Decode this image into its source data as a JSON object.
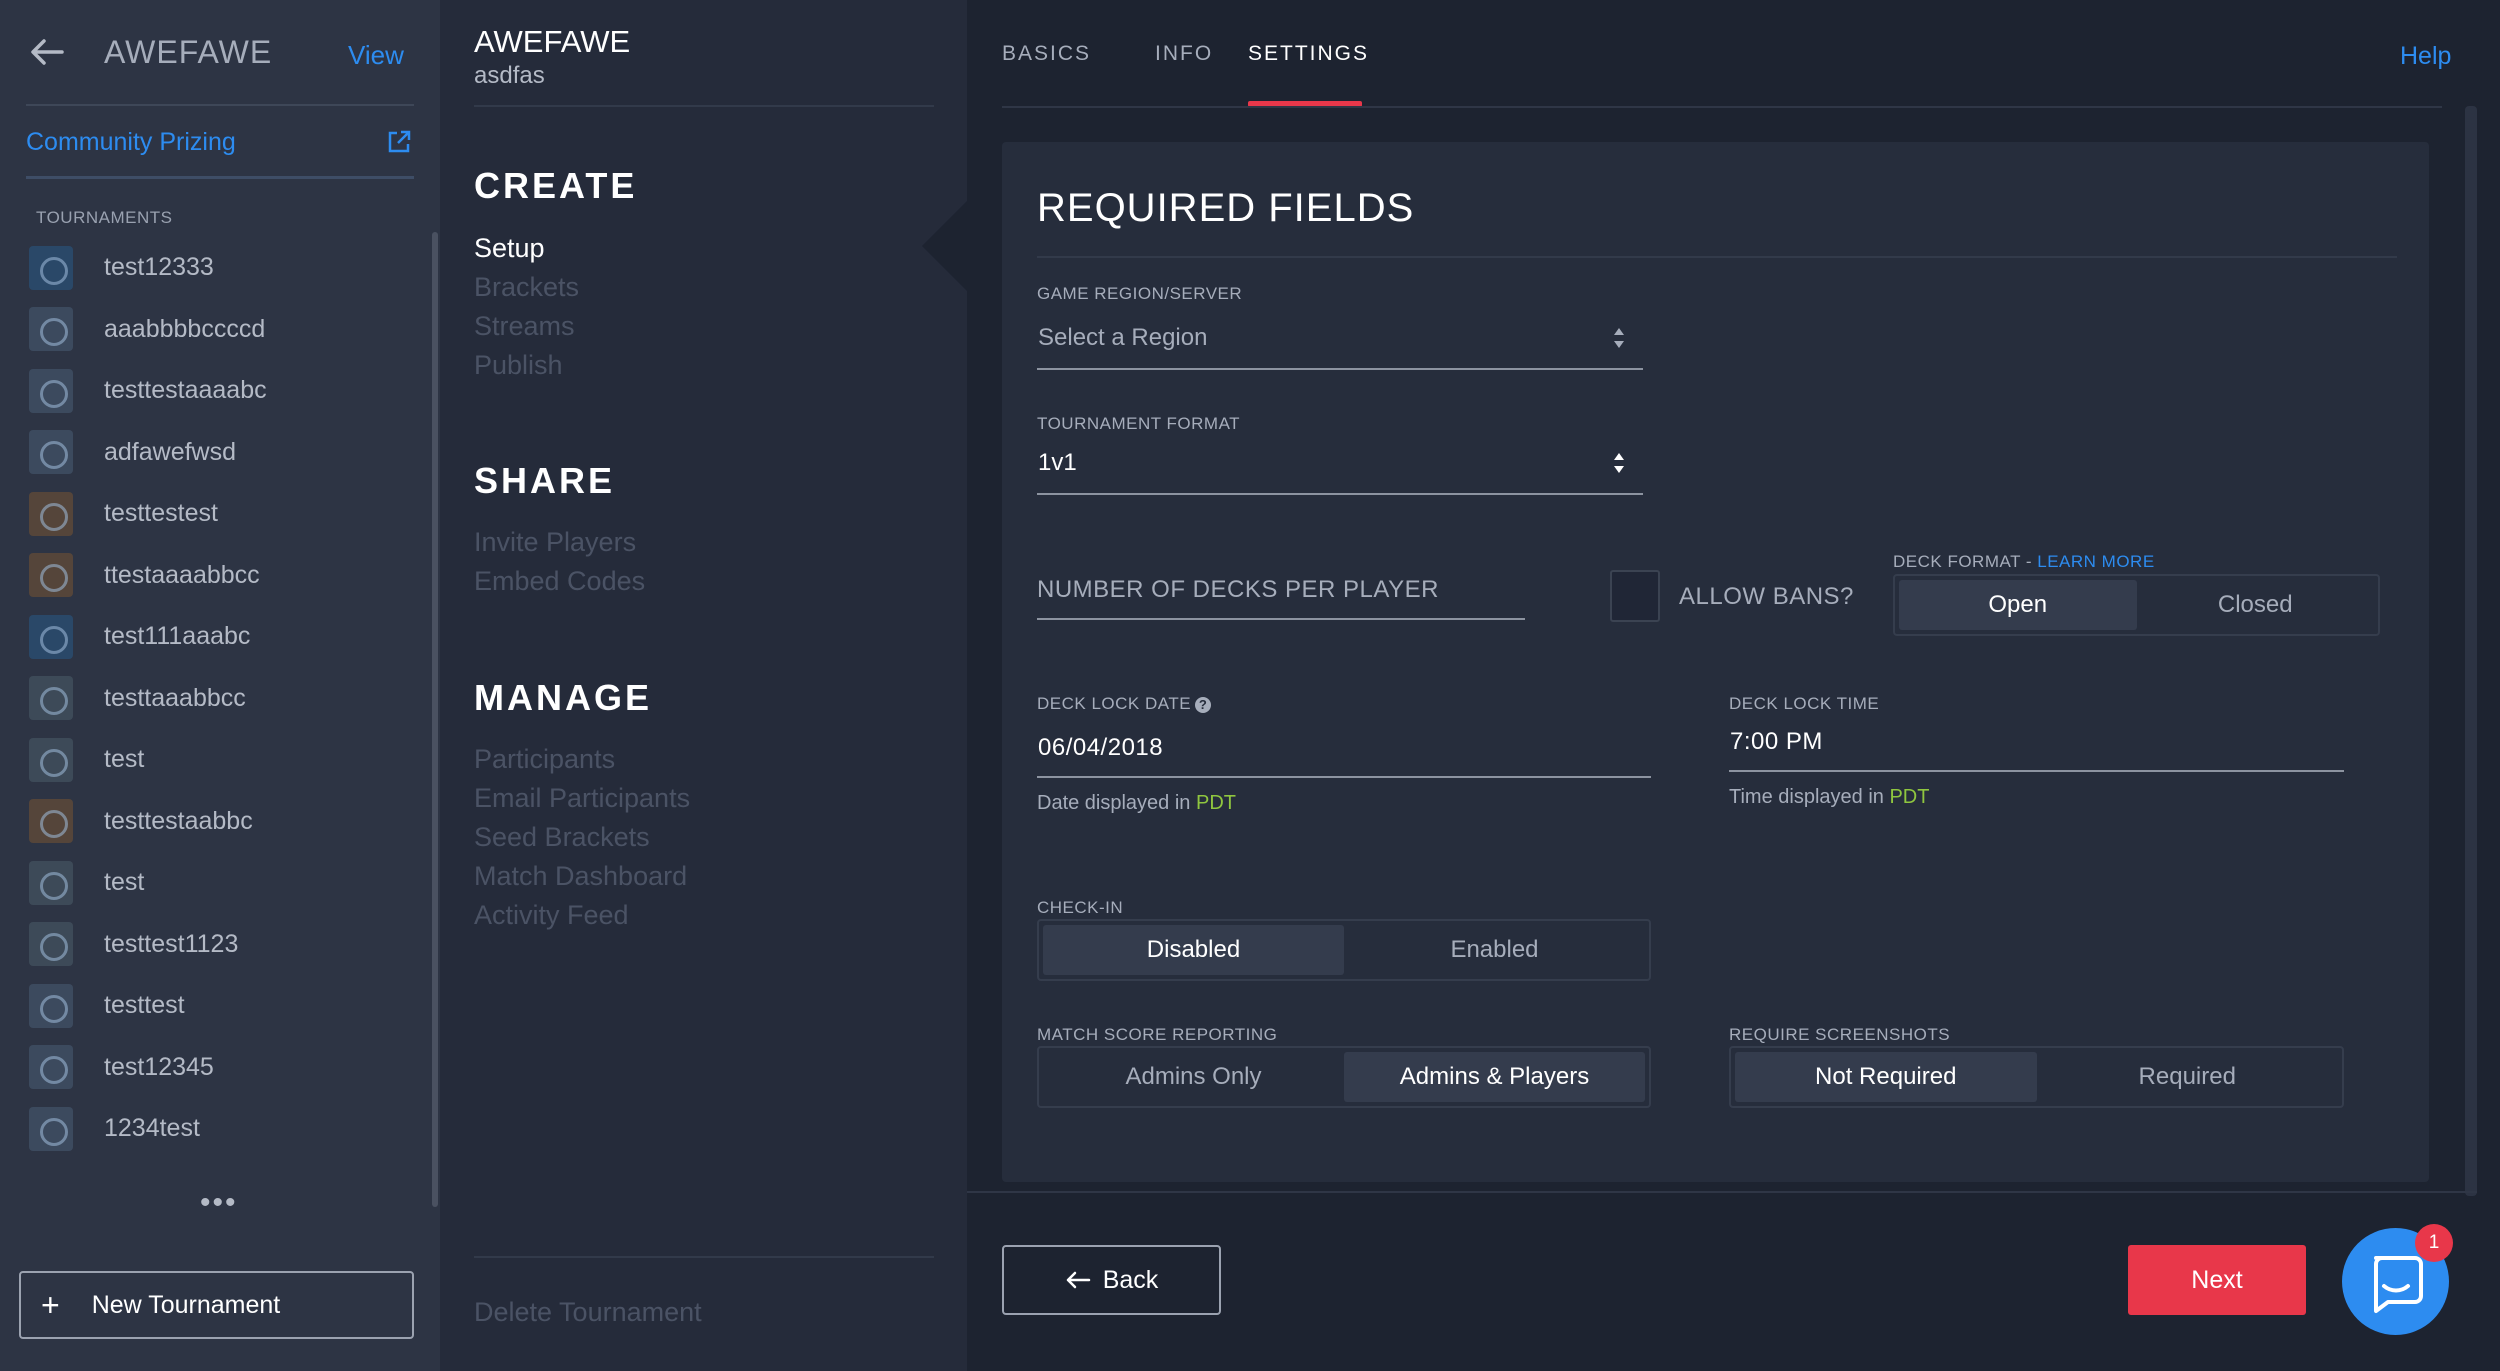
{
  "sidebar": {
    "title": "AWEFAWE",
    "view_label": "View",
    "community_prizing": "Community Prizing",
    "section_label": "TOURNAMENTS",
    "tournaments": [
      {
        "name": "test12333"
      },
      {
        "name": "aaabbbbccccd"
      },
      {
        "name": "testtestaaaabc"
      },
      {
        "name": "adfawefwsd"
      },
      {
        "name": "testtestest"
      },
      {
        "name": "ttestaaaabbcc"
      },
      {
        "name": "test111aaabc"
      },
      {
        "name": "testtaaabbcc"
      },
      {
        "name": "test"
      },
      {
        "name": "testtestaabbc"
      },
      {
        "name": "test"
      },
      {
        "name": "testtest1123"
      },
      {
        "name": "testtest"
      },
      {
        "name": "test12345"
      },
      {
        "name": "1234test"
      }
    ],
    "more": "•••",
    "new_tournament_label": "New Tournament",
    "new_tournament_plus": "+"
  },
  "midcol": {
    "title": "AWEFAWE",
    "subtitle": "asdfas",
    "create_heading": "CREATE",
    "create_items": [
      "Setup",
      "Brackets",
      "Streams",
      "Publish"
    ],
    "share_heading": "SHARE",
    "share_items": [
      "Invite Players",
      "Embed Codes"
    ],
    "manage_heading": "MANAGE",
    "manage_items": [
      "Participants",
      "Email Participants",
      "Seed Brackets",
      "Match Dashboard",
      "Activity Feed"
    ],
    "delete_label": "Delete Tournament"
  },
  "tabs": {
    "items": [
      "BASICS",
      "INFO",
      "SETTINGS"
    ],
    "active": "SETTINGS",
    "help_label": "Help"
  },
  "form": {
    "title": "REQUIRED FIELDS",
    "region_label": "GAME REGION/SERVER",
    "region_placeholder": "Select a Region",
    "format_label": "TOURNAMENT FORMAT",
    "format_value": "1v1",
    "decks_placeholder": "NUMBER OF DECKS PER PLAYER",
    "allow_bans_label": "ALLOW BANS?",
    "deck_format_label": "DECK FORMAT - ",
    "deck_format_learn": "LEARN MORE",
    "deck_format_options": [
      "Open",
      "Closed"
    ],
    "deck_format_selected": "Open",
    "deck_lock_date_label": "DECK LOCK DATE",
    "deck_lock_date_value": "06/04/2018",
    "date_hint_prefix": "Date displayed in ",
    "deck_lock_time_label": "DECK LOCK TIME",
    "deck_lock_time_value": "7:00 PM",
    "time_hint_prefix": "Time displayed in ",
    "timezone": "PDT",
    "checkin_label": "CHECK-IN",
    "checkin_options": [
      "Disabled",
      "Enabled"
    ],
    "checkin_selected": "Disabled",
    "score_label": "MATCH SCORE REPORTING",
    "score_options": [
      "Admins Only",
      "Admins & Players"
    ],
    "score_selected": "Admins & Players",
    "screens_label": "REQUIRE SCREENSHOTS",
    "screens_options": [
      "Not Required",
      "Required"
    ],
    "screens_selected": "Not Required"
  },
  "footer": {
    "back_label": "Back",
    "next_label": "Next",
    "chat_badge": "1"
  },
  "colors": {
    "accent_blue": "#2d8cf0",
    "accent_red": "#e8374a",
    "timezone_green": "#8fc63f"
  }
}
